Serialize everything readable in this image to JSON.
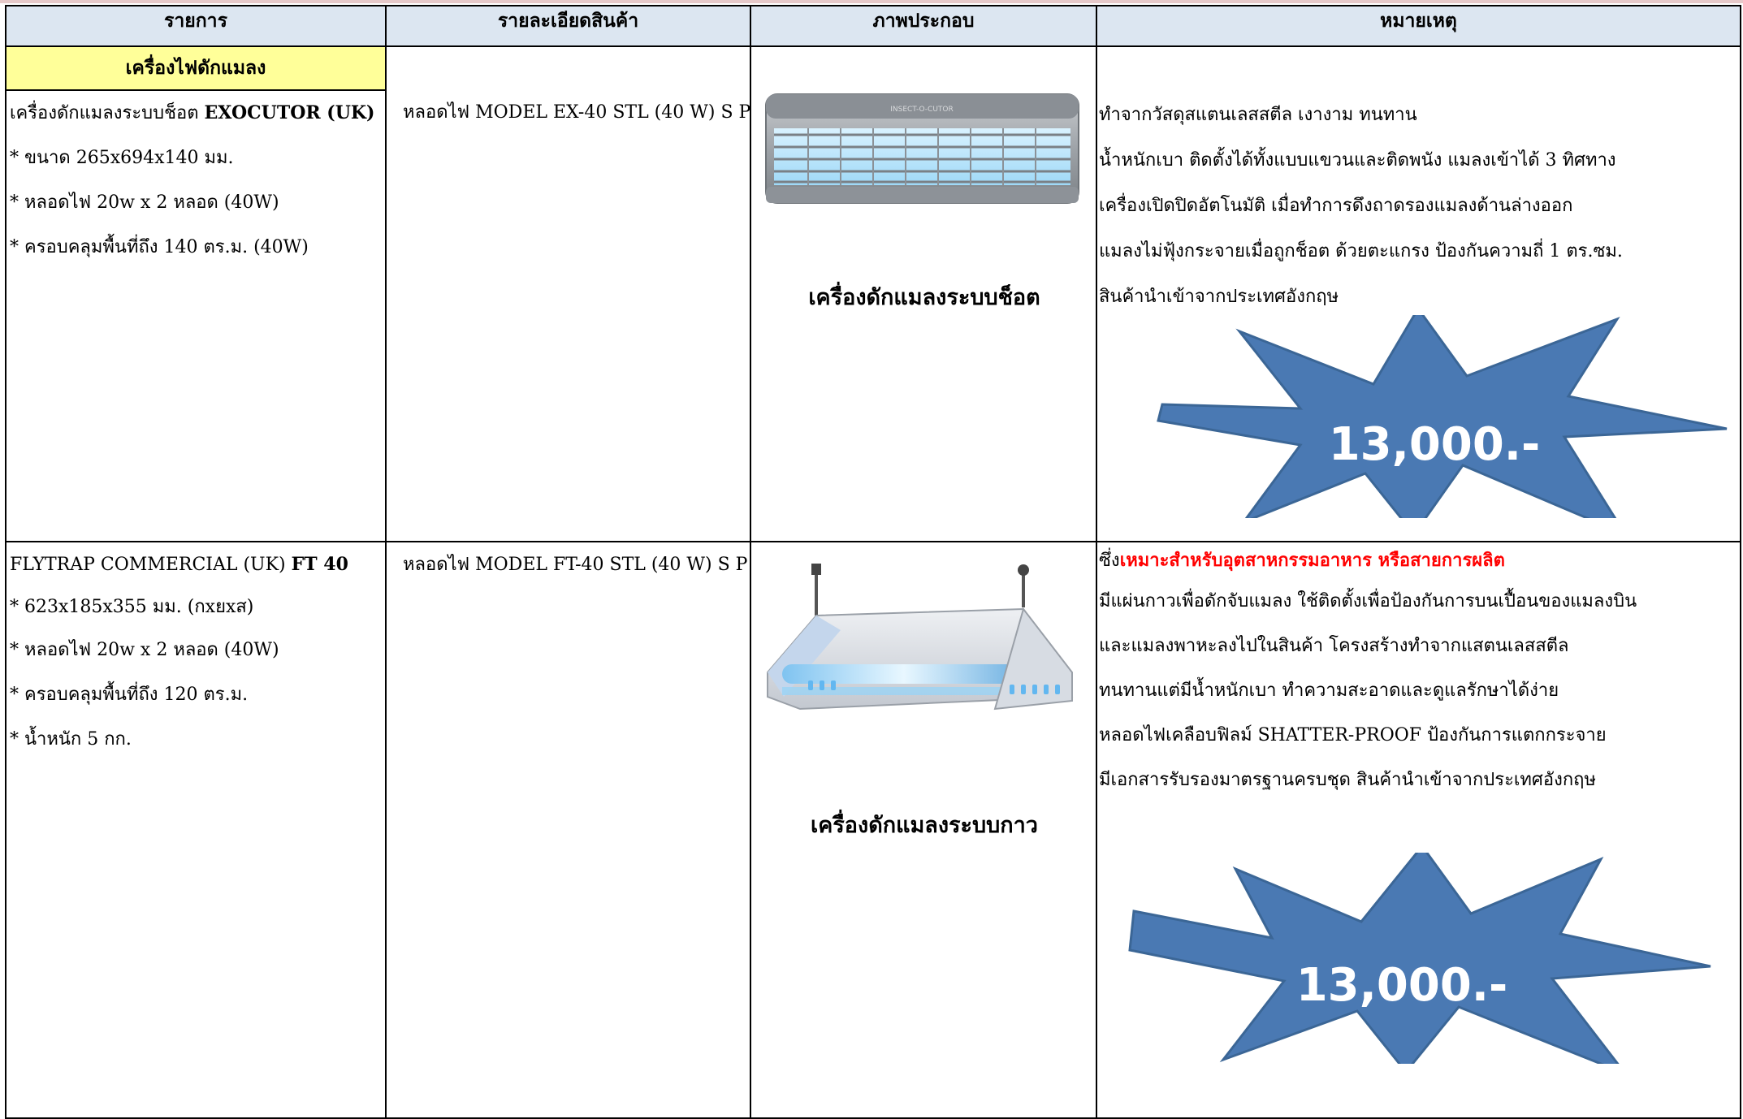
{
  "header": {
    "col1": "รายการ",
    "col2": "รายละเอียดสินค้า",
    "col3": "ภาพประกอบ",
    "col4": "หมายเหตุ"
  },
  "section_title": "เครื่องไฟดักแมลง",
  "products": [
    {
      "name_prefix": "เครื่องดักแมลงระบบช็อต ",
      "name_bold": "EXOCUTOR (UK)",
      "specs": [
        "*  ขนาด 265x694x140 มม.",
        "* หลอดไฟ 20w x 2 หลอด (40W)",
        "* ครอบคลุมพื้นที่ถึง 140 ตร.ม. (40W)"
      ],
      "detail": "หลอดไฟ MODEL EX-40 STL (40 W) S P",
      "image_brand": "INSECT-O-CUTOR",
      "caption": "เครื่องดักแมลงระบบช็อต",
      "notes": [
        " ทำจากวัสดุสแตนเลสสตีล เงางาม ทนทาน",
        "น้ำหนักเบา  ติดตั้งได้ทั้งแบบแขวนและติดพนัง แมลงเข้าได้ 3 ทิศทาง",
        " เครื่องเปิดปิดอัตโนมัติ  เมื่อทำการดึงถาดรองแมลงด้านล่างออก",
        "แมลงไม่ฟุ้งกระจายเมื่อถูกช็อต ด้วยตะแกรง  ป้องกันความถี่ 1 ตร.ซม.",
        "สินค้านำเข้าจากประเทศอังกฤษ"
      ],
      "price": "13,000.-"
    },
    {
      "name_prefix": "FLYTRAP COMMERCIAL (UK)  ",
      "name_bold": "FT 40",
      "specs": [
        "* 623x185x355 มม. (กxยxส)",
        "* หลอดไฟ 20w x 2 หลอด (40W)",
        "* ครอบคลุมพื้นที่ถึง 120 ตร.ม.",
        "* น้ำหนัก 5 กก."
      ],
      "detail": "หลอดไฟ MODEL FT-40 STL (40 W) S P",
      "caption": "เครื่องดักแมลงระบบกาว",
      "notes_first_prefix": "ซึ่ง",
      "notes_first_red": "เหมาะสำหรับอุตสาหกรรมอาหาร  หรือสายการผลิต",
      "notes": [
        " มีแผ่นกาวเพื่อดักจับแมลง  ใช้ติดตั้งเพื่อป้องกันการบนเปื้อนของแมลงบิน",
        "และแมลงพาหะลงไปในสินค้า  โครงสร้างทำจากแสตนเลสสตีล",
        "ทนทานแต่มีน้ำหนักเบา ทำความสะอาดและดูแลรักษาได้ง่าย",
        "หลอดไฟเคลือบฟิลม์ SHATTER-PROOF ป้องกันการแตกกระจาย",
        "มีเอกสารรับรองมาตรฐานครบชุด  สินค้านำเข้าจากประเทศอังกฤษ"
      ],
      "price": "13,000.-"
    }
  ],
  "colors": {
    "header_bg": "#dce6f1",
    "section_bg": "#ffff99",
    "star_fill": "#4a79b3",
    "star_stroke": "#3b6696",
    "highlight_red": "#ff0000"
  }
}
